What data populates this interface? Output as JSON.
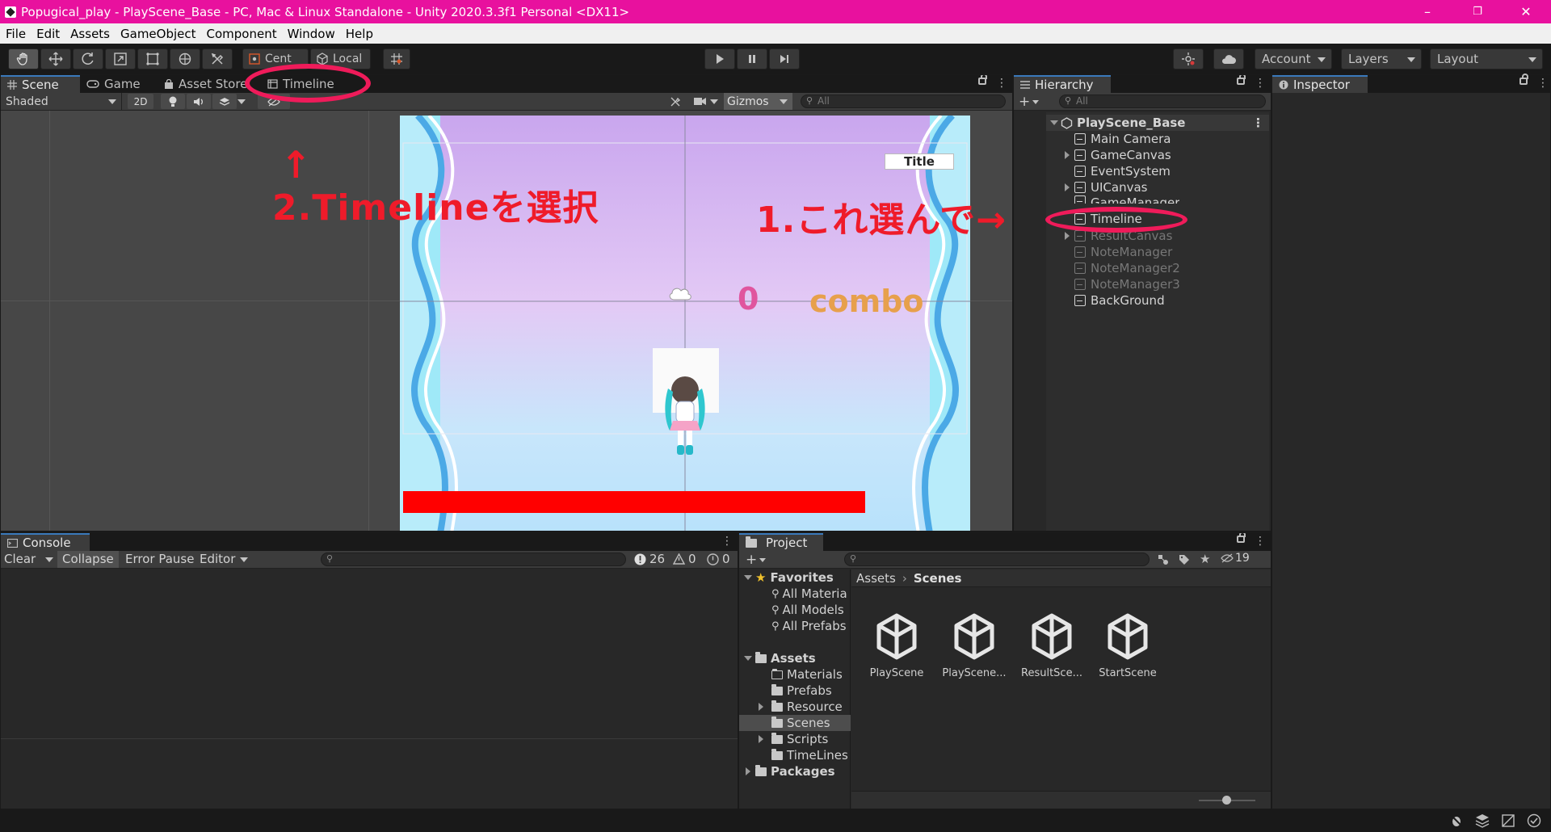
{
  "window": {
    "title": "Popugical_play - PlayScene_Base - PC, Mac & Linux Standalone - Unity 2020.3.3f1 Personal <DX11>",
    "min": "–",
    "max": "❐",
    "close": "✕"
  },
  "menu": [
    "File",
    "Edit",
    "Assets",
    "GameObject",
    "Component",
    "Window",
    "Help"
  ],
  "toolbar": {
    "pivot_label": "Cent",
    "space_label": "Local",
    "account": "Account",
    "layers": "Layers",
    "layout": "Layout"
  },
  "scene_panel": {
    "tabs": [
      "Scene",
      "Game",
      "Asset Store",
      "Timeline"
    ],
    "shading": "Shaded",
    "mode_2d": "2D",
    "gizmos": "Gizmos",
    "search_placeholder": "All"
  },
  "game": {
    "title_button": "Title",
    "score": "0",
    "combo_label": "combo"
  },
  "hierarchy": {
    "tab": "Hierarchy",
    "search_placeholder": "All",
    "scene_name": "PlayScene_Base",
    "items": [
      "Main Camera",
      "GameCanvas",
      "EventSystem",
      "UICanvas",
      "GameManager",
      "Timeline",
      "ResultCanvas",
      "NoteManager",
      "NoteManager2",
      "NoteManager3",
      "BackGround"
    ]
  },
  "inspector": {
    "tab": "Inspector"
  },
  "console": {
    "tab": "Console",
    "clear": "Clear",
    "collapse": "Collapse",
    "error_pause": "Error Pause",
    "editor": "Editor",
    "errors": "26",
    "warnings": "0",
    "infos": "0"
  },
  "project": {
    "tab": "Project",
    "hidden_count": "19",
    "favorites": "Favorites",
    "favorite_items": [
      "All Materia",
      "All Models",
      "All Prefabs"
    ],
    "assets": "Assets",
    "asset_folders": [
      "Materials",
      "Prefabs",
      "Resource",
      "Scenes",
      "Scripts",
      "TimeLines"
    ],
    "packages": "Packages",
    "breadcrumb": [
      "Assets",
      "Scenes"
    ],
    "scene_files": [
      "PlayScene",
      "PlayScene...",
      "ResultSce...",
      "StartScene"
    ]
  },
  "annotations": {
    "step1": "1.これ選んで→",
    "step2": "2.Timelineを選択",
    "arrow_up": "↑",
    "color": "#ef1b2a"
  }
}
